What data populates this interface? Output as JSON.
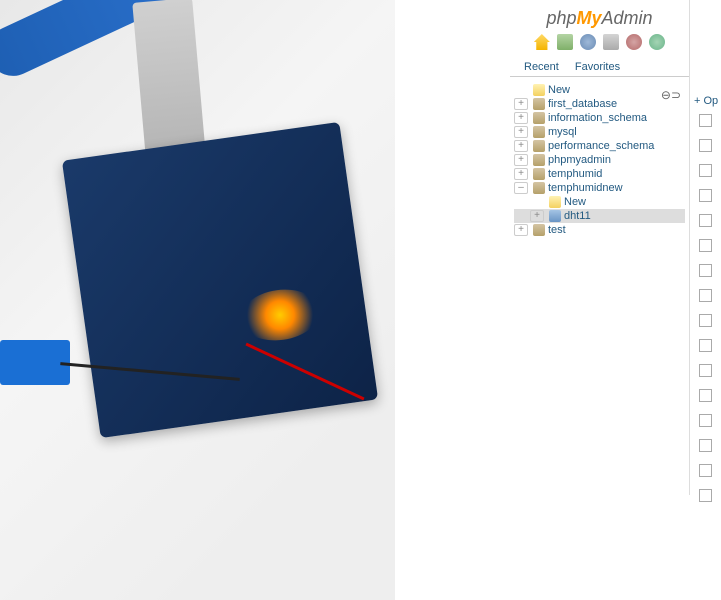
{
  "logo": {
    "php": "php",
    "my": "My",
    "admin": "Admin"
  },
  "tabs": {
    "recent": "Recent",
    "favorites": "Favorites"
  },
  "op_link": "+ Op",
  "tree": {
    "new": "New",
    "databases": [
      {
        "name": "first_database",
        "expanded": false
      },
      {
        "name": "information_schema",
        "expanded": false
      },
      {
        "name": "mysql",
        "expanded": false
      },
      {
        "name": "performance_schema",
        "expanded": false
      },
      {
        "name": "phpmyadmin",
        "expanded": false
      },
      {
        "name": "temphumid",
        "expanded": false
      },
      {
        "name": "temphumidnew",
        "expanded": true,
        "children": {
          "new": "New",
          "tables": [
            {
              "name": "dht11",
              "selected": true
            }
          ]
        }
      },
      {
        "name": "test",
        "expanded": false
      }
    ]
  },
  "checkbox_count": 16
}
